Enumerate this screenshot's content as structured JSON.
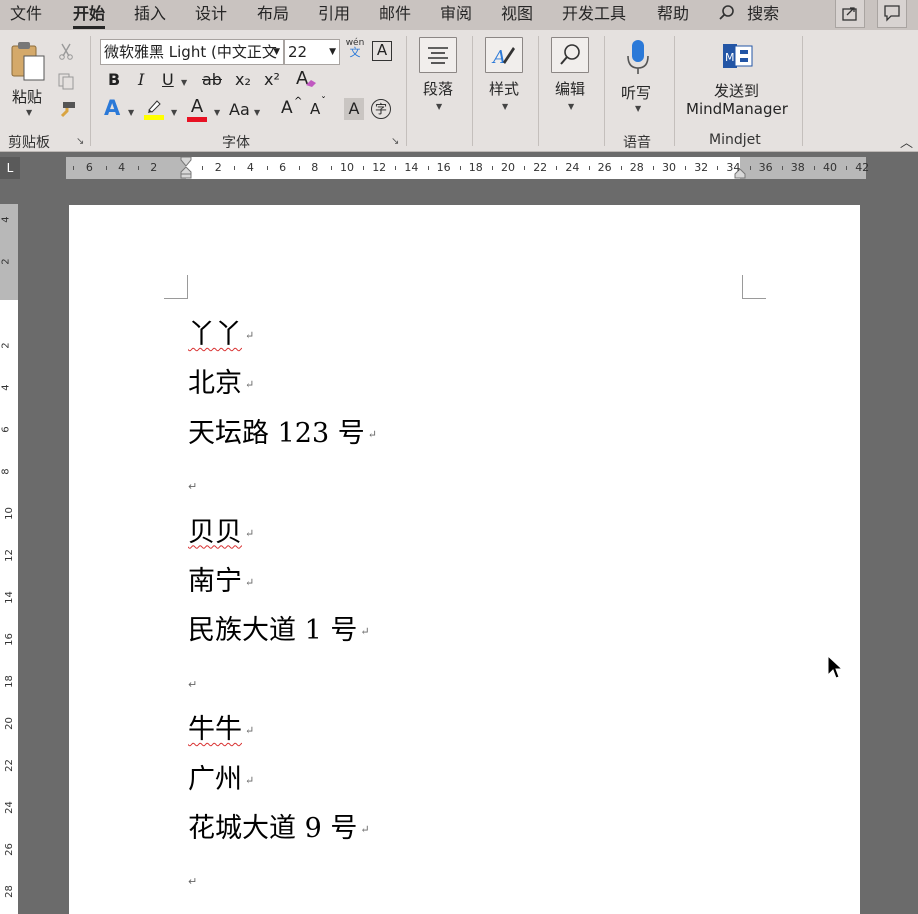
{
  "tabs": [
    "文件",
    "开始",
    "插入",
    "设计",
    "布局",
    "引用",
    "邮件",
    "审阅",
    "视图",
    "开发工具",
    "帮助"
  ],
  "active_tab": "开始",
  "search_label": "搜索",
  "clipboard": {
    "paste_label": "粘贴",
    "group_label": "剪贴板"
  },
  "font": {
    "name": "微软雅黑 Light (中文正文",
    "size": "22",
    "group_label": "字体",
    "wen_top": "wén",
    "wen_bottom": "文",
    "bold": "B",
    "italic": "I",
    "underline": "U",
    "strike": "ab",
    "sub": "x₂",
    "sup": "x²",
    "case": "Aa",
    "phonetic": "字",
    "grow": "A",
    "shrink": "A",
    "shade": "A",
    "textfx": "A",
    "highlight_a": "A",
    "boxA": "A"
  },
  "paragraph_label": "段落",
  "styles_label": "样式",
  "editing_label": "编辑",
  "voice": {
    "button_label": "听写",
    "group_label": "语音"
  },
  "mindjet": {
    "line1": "发送到",
    "line2": "MindManager",
    "group_label": "Mindjet"
  },
  "ruler_corner": "L",
  "ruler_numbers": [
    "6",
    "4",
    "2",
    "2",
    "4",
    "6",
    "8",
    "10",
    "12",
    "14",
    "16",
    "18",
    "20",
    "22",
    "24",
    "26",
    "28",
    "30",
    "32",
    "34",
    "36",
    "38",
    "40",
    "42"
  ],
  "vruler_numbers": [
    "4",
    "2",
    "2",
    "4",
    "6",
    "8",
    "10",
    "12",
    "14",
    "16",
    "18",
    "20",
    "22",
    "24",
    "26",
    "28"
  ],
  "document": {
    "lines": [
      {
        "text": "丫丫",
        "squiggle": true
      },
      {
        "text": "北京",
        "squiggle": false
      },
      {
        "text": "天坛路 123 号",
        "squiggle": false
      },
      {
        "text": "",
        "squiggle": false
      },
      {
        "text": "贝贝",
        "squiggle": true
      },
      {
        "text": "南宁",
        "squiggle": false
      },
      {
        "text": "民族大道 1 号",
        "squiggle": false
      },
      {
        "text": "",
        "squiggle": false
      },
      {
        "text": "牛牛",
        "squiggle": true
      },
      {
        "text": "广州",
        "squiggle": false
      },
      {
        "text": "花城大道 9 号",
        "squiggle": false
      },
      {
        "text": "",
        "squiggle": false
      }
    ],
    "paragraph_mark": "↵"
  },
  "colors": {
    "highlight": "#ffff00",
    "font_color": "#e81123",
    "text_effect": "#2b79d8"
  }
}
